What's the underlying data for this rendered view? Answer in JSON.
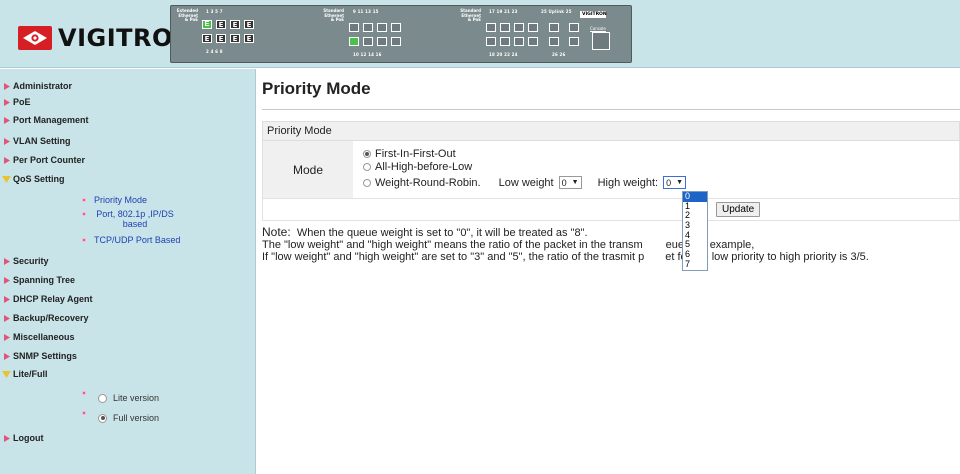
{
  "header": {
    "brand": "VIGITRON",
    "device": {
      "label_extended": "Extended\nEthernet\n& PoE",
      "label_standard_poe": "Standard\nEthernet\n& PoE",
      "label_standard": "Standard\nEthernet\n& PoE",
      "top_nums_a": "1  3  5  7",
      "bottom_nums_a": "2  4  6  8",
      "top_nums_b": "9  11  13  15",
      "bottom_nums_b": "10  12  14  16",
      "top_nums_c": "17  19  21  23",
      "bottom_nums_c": "18  20  22  24",
      "uplink_top": "25  Uplink  25",
      "uplink_bottom": "26        26",
      "console": "Console",
      "mini_brand": "VIGITRON",
      "port_e": "E",
      "port_g": "E"
    }
  },
  "sidebar": {
    "items": [
      {
        "label": "Administrator"
      },
      {
        "label": "PoE"
      },
      {
        "label": "Port Management"
      },
      {
        "label": "VLAN Setting"
      },
      {
        "label": "Per Port Counter"
      },
      {
        "label": "QoS Setting"
      },
      {
        "label": "Security"
      },
      {
        "label": "Spanning Tree"
      },
      {
        "label": "DHCP Relay Agent"
      },
      {
        "label": "Backup/Recovery"
      },
      {
        "label": "Miscellaneous"
      },
      {
        "label": "SNMP Settings"
      },
      {
        "label": "Lite/Full"
      },
      {
        "label": "Logout"
      }
    ],
    "qos_sub": [
      {
        "label": "Priority Mode"
      },
      {
        "label": "Port, 802.1p ,IP/DS based"
      },
      {
        "label": "TCP/UDP Port Based"
      }
    ],
    "lite_full": {
      "lite": "Lite version",
      "full": "Full version",
      "selected": "Full version"
    }
  },
  "main": {
    "title": "Priority Mode",
    "panel_header": "Priority Mode",
    "mode_label": "Mode",
    "options": [
      {
        "label": "First-In-First-Out",
        "checked": true
      },
      {
        "label": "All-High-before-Low",
        "checked": false
      },
      {
        "label": "Weight-Round-Robin.",
        "checked": false
      }
    ],
    "low_weight_label": "Low weight",
    "low_weight_value": "0",
    "high_weight_label": "High weight:",
    "high_weight_value": "0",
    "update_label": "Update",
    "note_head": "Note:",
    "note_line1": "When the queue weight is set to \"0\", it will be treated as \"8\".",
    "note_line2": "The \"low weight\" and \"high weight\" means the ratio of the packet in the transm",
    "note_line2b": "eue. For example,",
    "note_line3": "If \"low weight\" and \"high weight\" are set to \"3\" and \"5\", the ratio of the trasmit p",
    "note_line3b": "et for the low priority to high priority is 3/5.",
    "dropdown_options": [
      "0",
      "1",
      "2",
      "3",
      "4",
      "5",
      "6",
      "7"
    ],
    "dropdown_selected": "0"
  },
  "colors": {
    "sidebar_bg": "#c9e4e8",
    "brand_red": "#d61e25",
    "link_blue": "#1d3fb3",
    "dropdown_highlight": "#1e64c8"
  }
}
